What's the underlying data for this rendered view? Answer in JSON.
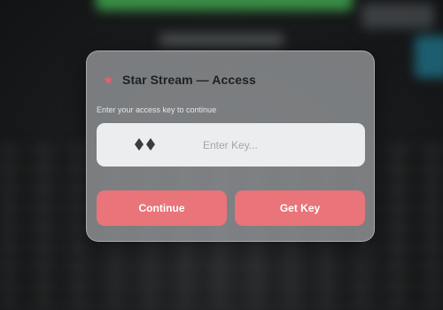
{
  "dialog": {
    "title": "Star Stream — Access",
    "subtitle": "Enter your access key to continue",
    "key_placeholder": "Enter Key...",
    "key_value": "",
    "icons": {
      "title": "star-icon",
      "key": "diamond-key-icon"
    },
    "continue_label": "Continue",
    "get_key_label": "Get Key"
  },
  "colors": {
    "accent": "#e97479",
    "star": "#e8616a",
    "panel": "#96999b",
    "field": "#ecedee"
  }
}
